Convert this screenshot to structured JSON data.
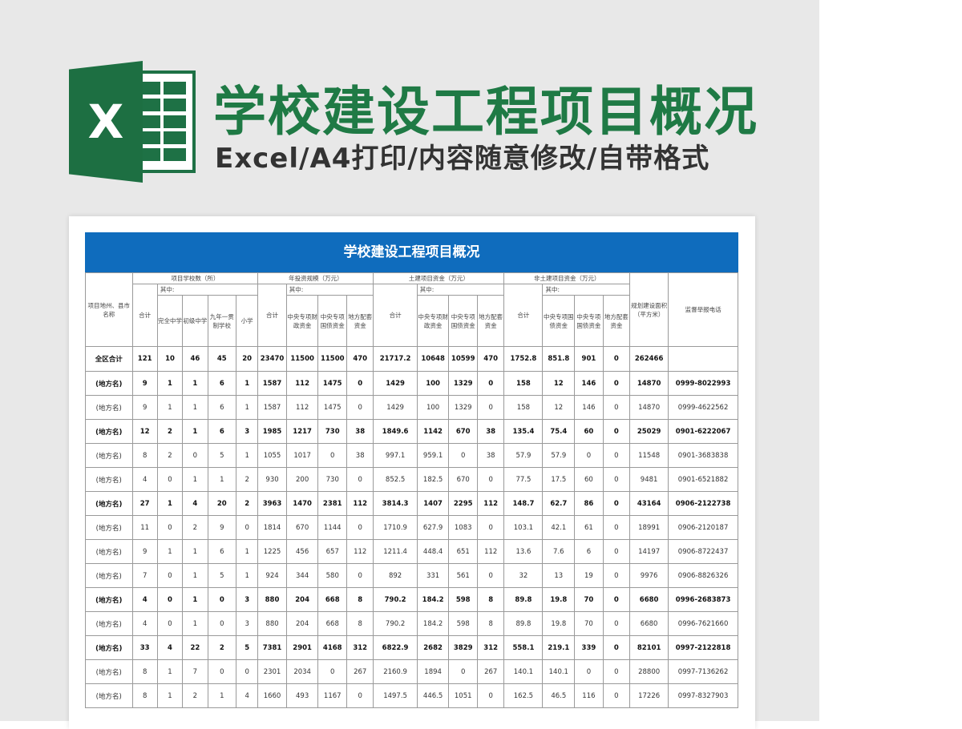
{
  "hero": {
    "logo_letter": "X",
    "title": "学校建设工程项目概况",
    "subtitle": "Excel/A4打印/内容随意修改/自带格式"
  },
  "colors": {
    "brand_green": "#1f7a45",
    "banner_blue": "#0f6cbd",
    "background": "#e8e8e8"
  },
  "sheet": {
    "banner_title": "学校建设工程项目概况",
    "headers": {
      "region": "项目地州、县市名称",
      "schools_group": "项目学校数（所）",
      "invest_group": "年投资规模（万元）",
      "civil_group": "土建项目资金（万元）",
      "nonciv_group": "非土建项目资金（万元）",
      "area": "规划建设面积（平方米）",
      "phone": "监督举报电话",
      "of_which": "其中:",
      "total": "合计",
      "s1": "完全中学",
      "s2": "初级中学",
      "s3": "九年一贯制学校",
      "s4": "小学",
      "f1": "中央专项财政资金",
      "f2": "中央专项国债资金",
      "f3": "地方配套资金",
      "c1": "中央专项财政资金",
      "c2": "中央专项国债资金",
      "c3": "地方配套资金",
      "n1": "中央专项国债资金",
      "n2": "中央专项国债资金",
      "n3": "地方配套资金"
    },
    "total_row": [
      "全区合计",
      "121",
      "10",
      "46",
      "45",
      "20",
      "23470",
      "11500",
      "11500",
      "470",
      "21717.2",
      "10648",
      "10599",
      "470",
      "1752.8",
      "851.8",
      "901",
      "0",
      "262466",
      ""
    ],
    "rows": [
      {
        "bold": true,
        "cells": [
          "(地方名)",
          "9",
          "1",
          "1",
          "6",
          "1",
          "1587",
          "112",
          "1475",
          "0",
          "1429",
          "100",
          "1329",
          "0",
          "158",
          "12",
          "146",
          "0",
          "14870",
          "0999-8022993"
        ]
      },
      {
        "bold": false,
        "cells": [
          "(地方名)",
          "9",
          "1",
          "1",
          "6",
          "1",
          "1587",
          "112",
          "1475",
          "0",
          "1429",
          "100",
          "1329",
          "0",
          "158",
          "12",
          "146",
          "0",
          "14870",
          "0999-4622562"
        ]
      },
      {
        "bold": true,
        "cells": [
          "(地方名)",
          "12",
          "2",
          "1",
          "6",
          "3",
          "1985",
          "1217",
          "730",
          "38",
          "1849.6",
          "1142",
          "670",
          "38",
          "135.4",
          "75.4",
          "60",
          "0",
          "25029",
          "0901-6222067"
        ]
      },
      {
        "bold": false,
        "cells": [
          "(地方名)",
          "8",
          "2",
          "0",
          "5",
          "1",
          "1055",
          "1017",
          "0",
          "38",
          "997.1",
          "959.1",
          "0",
          "38",
          "57.9",
          "57.9",
          "0",
          "0",
          "11548",
          "0901-3683838"
        ]
      },
      {
        "bold": false,
        "cells": [
          "(地方名)",
          "4",
          "0",
          "1",
          "1",
          "2",
          "930",
          "200",
          "730",
          "0",
          "852.5",
          "182.5",
          "670",
          "0",
          "77.5",
          "17.5",
          "60",
          "0",
          "9481",
          "0901-6521882"
        ]
      },
      {
        "bold": true,
        "cells": [
          "(地方名)",
          "27",
          "1",
          "4",
          "20",
          "2",
          "3963",
          "1470",
          "2381",
          "112",
          "3814.3",
          "1407",
          "2295",
          "112",
          "148.7",
          "62.7",
          "86",
          "0",
          "43164",
          "0906-2122738"
        ]
      },
      {
        "bold": false,
        "cells": [
          "(地方名)",
          "11",
          "0",
          "2",
          "9",
          "0",
          "1814",
          "670",
          "1144",
          "0",
          "1710.9",
          "627.9",
          "1083",
          "0",
          "103.1",
          "42.1",
          "61",
          "0",
          "18991",
          "0906-2120187"
        ]
      },
      {
        "bold": false,
        "cells": [
          "(地方名)",
          "9",
          "1",
          "1",
          "6",
          "1",
          "1225",
          "456",
          "657",
          "112",
          "1211.4",
          "448.4",
          "651",
          "112",
          "13.6",
          "7.6",
          "6",
          "0",
          "14197",
          "0906-8722437"
        ]
      },
      {
        "bold": false,
        "cells": [
          "(地方名)",
          "7",
          "0",
          "1",
          "5",
          "1",
          "924",
          "344",
          "580",
          "0",
          "892",
          "331",
          "561",
          "0",
          "32",
          "13",
          "19",
          "0",
          "9976",
          "0906-8826326"
        ]
      },
      {
        "bold": true,
        "cells": [
          "(地方名)",
          "4",
          "0",
          "1",
          "0",
          "3",
          "880",
          "204",
          "668",
          "8",
          "790.2",
          "184.2",
          "598",
          "8",
          "89.8",
          "19.8",
          "70",
          "0",
          "6680",
          "0996-2683873"
        ]
      },
      {
        "bold": false,
        "cells": [
          "(地方名)",
          "4",
          "0",
          "1",
          "0",
          "3",
          "880",
          "204",
          "668",
          "8",
          "790.2",
          "184.2",
          "598",
          "8",
          "89.8",
          "19.8",
          "70",
          "0",
          "6680",
          "0996-7621660"
        ]
      },
      {
        "bold": true,
        "cells": [
          "(地方名)",
          "33",
          "4",
          "22",
          "2",
          "5",
          "7381",
          "2901",
          "4168",
          "312",
          "6822.9",
          "2682",
          "3829",
          "312",
          "558.1",
          "219.1",
          "339",
          "0",
          "82101",
          "0997-2122818"
        ]
      },
      {
        "bold": false,
        "cells": [
          "(地方名)",
          "8",
          "1",
          "7",
          "0",
          "0",
          "2301",
          "2034",
          "0",
          "267",
          "2160.9",
          "1894",
          "0",
          "267",
          "140.1",
          "140.1",
          "0",
          "0",
          "28800",
          "0997-7136262"
        ]
      },
      {
        "bold": false,
        "cells": [
          "(地方名)",
          "8",
          "1",
          "2",
          "1",
          "4",
          "1660",
          "493",
          "1167",
          "0",
          "1497.5",
          "446.5",
          "1051",
          "0",
          "162.5",
          "46.5",
          "116",
          "0",
          "17226",
          "0997-8327903"
        ]
      }
    ]
  }
}
